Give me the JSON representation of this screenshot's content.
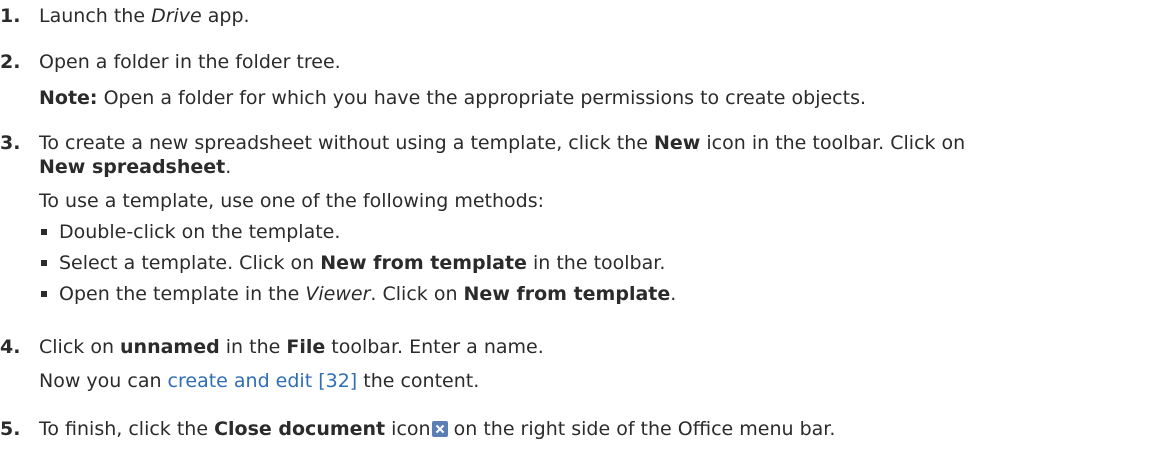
{
  "steps": [
    {
      "number": "1.",
      "pre": "Launch the ",
      "italic": "Drive",
      "post": " app."
    },
    {
      "number": "2.",
      "text": "Open a folder in the folder tree.",
      "note_label": "Note:",
      "note_text": " Open a folder for which you have the appropriate permissions to create objects."
    },
    {
      "number": "3.",
      "p1_a": "To create a new spreadsheet without using a template, click the ",
      "p1_b": "New",
      "p1_c": " icon in the toolbar. Click on",
      "p1_d": "New spreadsheet",
      "p1_e": ".",
      "p2": "To use a template, use one of the following methods:",
      "bullet1": "Double-click on the template.",
      "bullet2_a": "Select a template. Click on ",
      "bullet2_b": "New from template",
      "bullet2_c": " in the toolbar.",
      "bullet3_a": "Open the template in the ",
      "bullet3_b": "Viewer",
      "bullet3_c": ". Click on ",
      "bullet3_d": "New from template",
      "bullet3_e": "."
    },
    {
      "number": "4.",
      "a": "Click on ",
      "b": "unnamed",
      "c": " in the ",
      "d": "File",
      "e": " toolbar. Enter a name.",
      "p2_a": "Now you can ",
      "p2_link": "create and edit [32]",
      "p2_b": " the content."
    },
    {
      "number": "5.",
      "a": "To finish, click the ",
      "b": "Close document",
      "c": " icon",
      "d": " on the right side of the Office menu bar."
    }
  ],
  "colors": {
    "text": "#2b2b2b",
    "link": "#2f6db5",
    "icon_bg": "#5b7fb5"
  },
  "icons": {
    "close_document": "close-document-icon"
  }
}
